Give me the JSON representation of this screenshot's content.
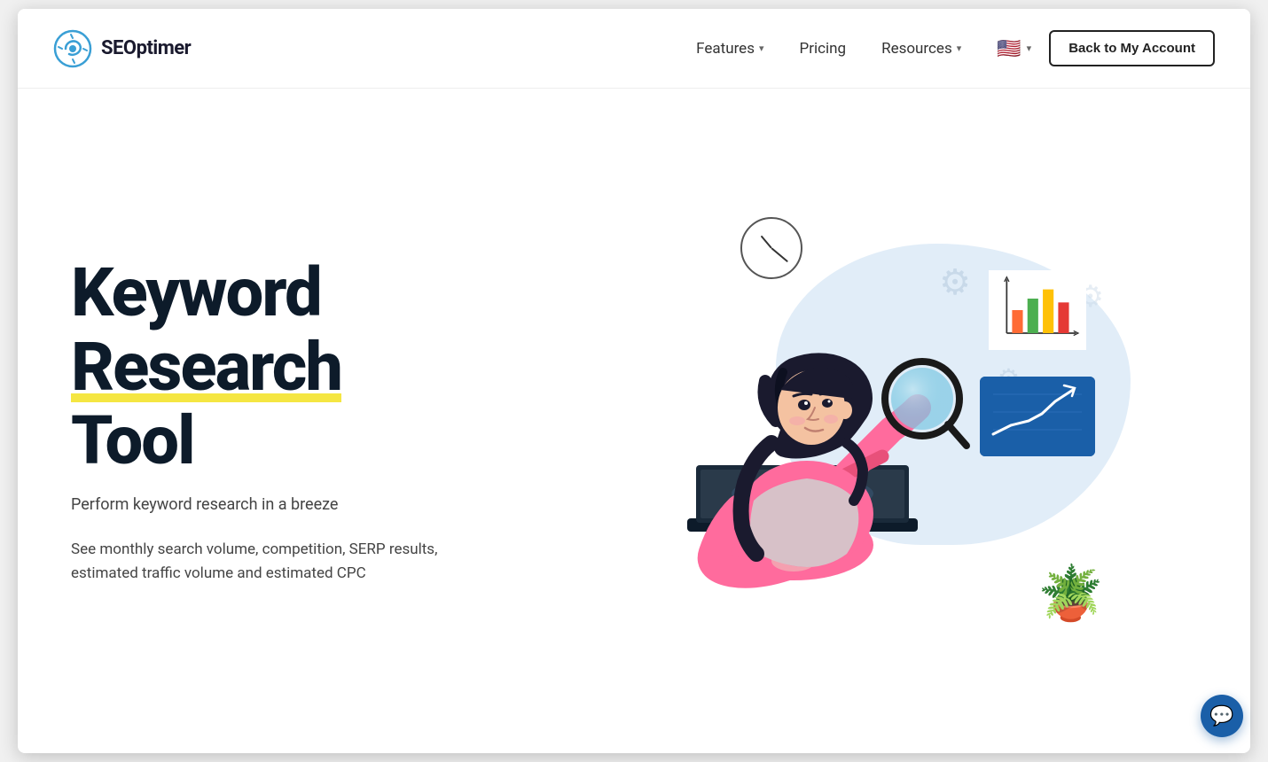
{
  "brand": {
    "name": "SEOptimer",
    "logo_alt": "SEOptimer logo"
  },
  "nav": {
    "features_label": "Features",
    "pricing_label": "Pricing",
    "resources_label": "Resources",
    "language_label": "EN",
    "back_button_label": "Back to My Account"
  },
  "hero": {
    "title_line1": "Keyword",
    "title_line2": "Research",
    "title_line3": "Tool",
    "subtitle": "Perform keyword research in a breeze",
    "description": "See monthly search volume, competition, SERP results, estimated traffic volume and estimated CPC"
  },
  "chat": {
    "icon": "💬"
  }
}
